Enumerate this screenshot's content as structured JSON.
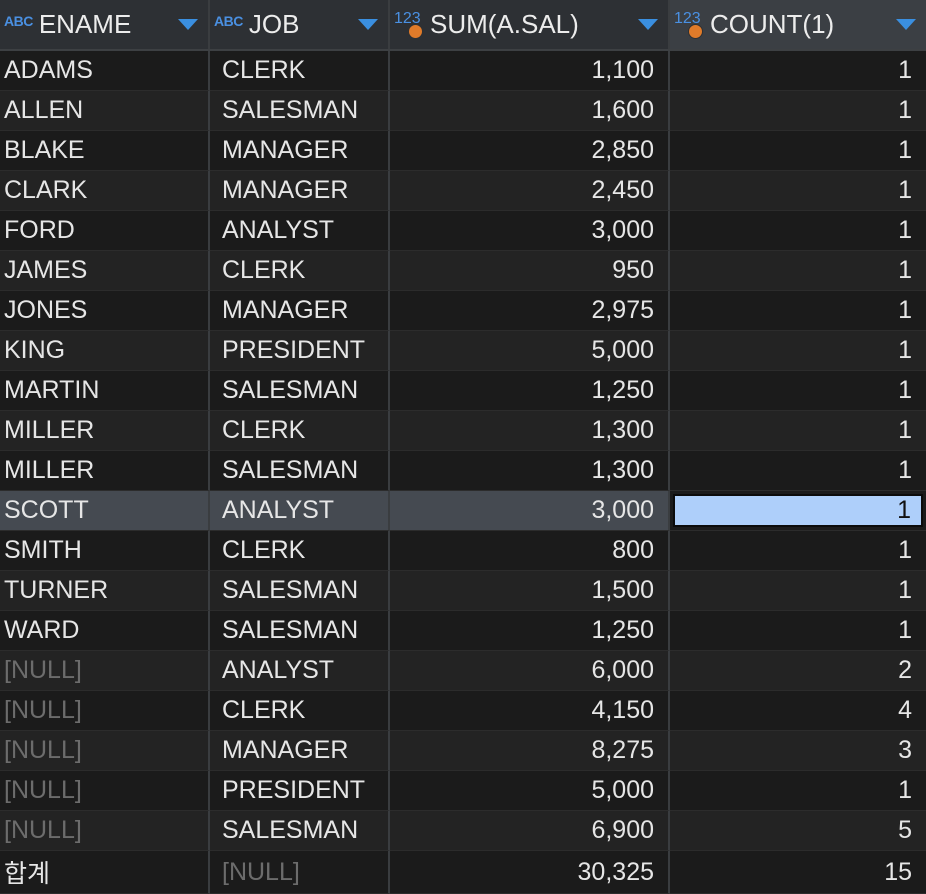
{
  "columns": [
    {
      "label": "ENAME",
      "type_icon": "ABC",
      "type_icon_name": "text-type-icon"
    },
    {
      "label": "JOB",
      "type_icon": "ABC",
      "type_icon_name": "text-type-icon"
    },
    {
      "label": "SUM(A.SAL)",
      "type_icon": "123",
      "type_icon_name": "numeric-type-icon"
    },
    {
      "label": "COUNT(1)",
      "type_icon": "123",
      "type_icon_name": "numeric-type-icon"
    }
  ],
  "rows": [
    [
      "ADAMS",
      "CLERK",
      "1,100",
      "1"
    ],
    [
      "ALLEN",
      "SALESMAN",
      "1,600",
      "1"
    ],
    [
      "BLAKE",
      "MANAGER",
      "2,850",
      "1"
    ],
    [
      "CLARK",
      "MANAGER",
      "2,450",
      "1"
    ],
    [
      "FORD",
      "ANALYST",
      "3,000",
      "1"
    ],
    [
      "JAMES",
      "CLERK",
      "950",
      "1"
    ],
    [
      "JONES",
      "MANAGER",
      "2,975",
      "1"
    ],
    [
      "KING",
      "PRESIDENT",
      "5,000",
      "1"
    ],
    [
      "MARTIN",
      "SALESMAN",
      "1,250",
      "1"
    ],
    [
      "MILLER",
      "CLERK",
      "1,300",
      "1"
    ],
    [
      "MILLER",
      "SALESMAN",
      "1,300",
      "1"
    ],
    [
      "SCOTT",
      "ANALYST",
      "3,000",
      "1"
    ],
    [
      "SMITH",
      "CLERK",
      "800",
      "1"
    ],
    [
      "TURNER",
      "SALESMAN",
      "1,500",
      "1"
    ],
    [
      "WARD",
      "SALESMAN",
      "1,250",
      "1"
    ],
    [
      "[NULL]",
      "ANALYST",
      "6,000",
      "2"
    ],
    [
      "[NULL]",
      "CLERK",
      "4,150",
      "4"
    ],
    [
      "[NULL]",
      "MANAGER",
      "8,275",
      "3"
    ],
    [
      "[NULL]",
      "PRESIDENT",
      "5,000",
      "1"
    ],
    [
      "[NULL]",
      "SALESMAN",
      "6,900",
      "5"
    ],
    [
      "합계",
      "[NULL]",
      "30,325",
      "15"
    ]
  ],
  "selected_row_index": 11,
  "focused_column_index": 3,
  "null_text": "[NULL]",
  "colors": {
    "background": "#1e1e1e",
    "header_bg": "#2d3034",
    "accent": "#3a8fe0",
    "selected_row": "#454a51",
    "focused_cell": "#aecffa",
    "null_text": "#6c6c6c",
    "numeric_badge_dot": "#e07b2a"
  }
}
